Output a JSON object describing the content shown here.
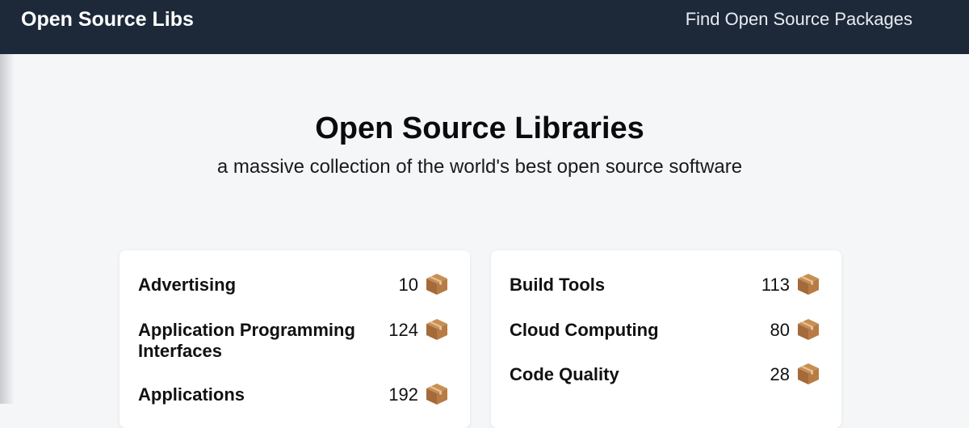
{
  "navbar": {
    "brand": "Open Source Libs",
    "link": "Find Open Source Packages",
    "bg_color": "#1d2939"
  },
  "hero": {
    "title": "Open Source Libraries",
    "subtitle": "a massive collection of the world's best open source software"
  },
  "package_icon": "package-box-icon",
  "cards": [
    {
      "categories": [
        {
          "name": "Advertising",
          "count": "10"
        },
        {
          "name": "Application Programming Interfaces",
          "count": "124"
        },
        {
          "name": "Applications",
          "count": "192"
        }
      ]
    },
    {
      "categories": [
        {
          "name": "Build Tools",
          "count": "113"
        },
        {
          "name": "Cloud Computing",
          "count": "80"
        },
        {
          "name": "Code Quality",
          "count": "28"
        }
      ]
    }
  ]
}
